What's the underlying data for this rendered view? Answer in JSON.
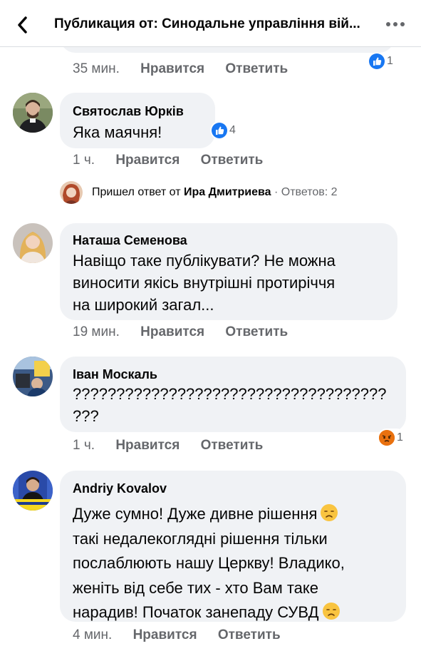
{
  "header": {
    "title": "Публикация от: Синодальне управління вій..."
  },
  "comments": [
    {
      "time": "35 мин.",
      "like_label": "Нравится",
      "reply_label": "Ответить",
      "reaction": {
        "icon": "like-icon",
        "count": "1"
      }
    },
    {
      "author": "Святослав Юрків",
      "text_lines": [
        "Яка маячня!"
      ],
      "time": "1 ч.",
      "like_label": "Нравится",
      "reply_label": "Ответить",
      "reaction": {
        "icon": "like-icon",
        "count": "4"
      }
    },
    {
      "author": "Наташа Семенова",
      "text_lines": [
        "Навіщо таке публікувати? Не можна",
        "виносити якісь внутрішні протиріччя",
        "на широкий загал..."
      ],
      "time": "19 мин.",
      "like_label": "Нравится",
      "reply_label": "Ответить"
    },
    {
      "author": "Іван Москаль",
      "text_lines": [
        "????????????????????????????????????",
        "???"
      ],
      "time": "1 ч.",
      "like_label": "Нравится",
      "reply_label": "Ответить",
      "reaction": {
        "icon": "angry-icon",
        "count": "1"
      }
    },
    {
      "author": "Andriy Kovalov",
      "text_lines": [
        "Дуже сумно! Дуже дивне рішення",
        "такі недалекоглядні рішення тільки",
        "послаблюють нашу Церкву! Владико,",
        "женіть від себе тих - хто Вам таке",
        "нарадив! Початок занепаду СУВД"
      ],
      "time": "4 мин.",
      "like_label": "Нравится",
      "reply_label": "Ответить"
    }
  ],
  "reply_summary": {
    "prefix": "Пришел ответ от ",
    "name": "Ира Дмитриева",
    "count_text": " · Ответов: 2"
  },
  "colors": {
    "bubble": "#f0f2f5",
    "meta_text": "#65676b",
    "like_blue": "#1877f2",
    "angry_orange": "#e9710f"
  }
}
